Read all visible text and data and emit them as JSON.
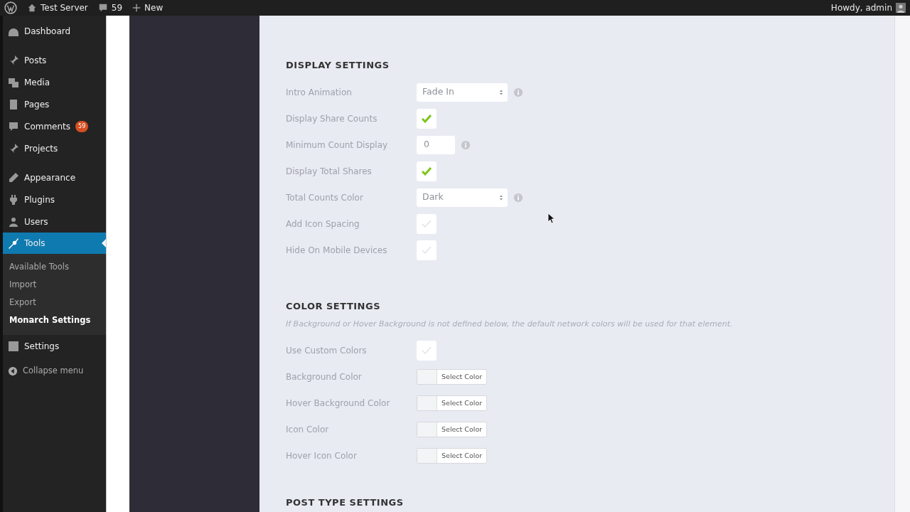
{
  "admin_bar": {
    "site": "Test Server",
    "comments": "59",
    "new": "New",
    "greeting": "Howdy, admin"
  },
  "sidebar": {
    "groups": [
      {
        "items": [
          {
            "label": "Dashboard",
            "selected": false
          }
        ]
      },
      {
        "items": [
          {
            "label": "Posts",
            "selected": false
          },
          {
            "label": "Media",
            "selected": false
          },
          {
            "label": "Pages",
            "selected": false
          },
          {
            "label": "Comments",
            "selected": false,
            "badge": "59"
          },
          {
            "label": "Projects",
            "selected": false
          }
        ]
      },
      {
        "items": [
          {
            "label": "Appearance",
            "selected": false
          },
          {
            "label": "Plugins",
            "selected": false
          },
          {
            "label": "Users",
            "selected": false
          },
          {
            "label": "Tools",
            "selected": true,
            "submenu": [
              {
                "label": "Available Tools",
                "selected": false
              },
              {
                "label": "Import",
                "selected": false
              },
              {
                "label": "Export",
                "selected": false
              },
              {
                "label": "Monarch Settings",
                "selected": true
              }
            ]
          },
          {
            "label": "Settings",
            "selected": false
          }
        ]
      }
    ],
    "collapse": "Collapse menu"
  },
  "sections": [
    {
      "title": "DISPLAY SETTINGS",
      "rows": [
        {
          "kind": "select",
          "label": "Intro Animation",
          "value": "Fade In",
          "info": true
        },
        {
          "kind": "checkbox",
          "label": "Display Share Counts",
          "checked": true
        },
        {
          "kind": "number",
          "label": "Minimum Count Display",
          "value": "0",
          "info": true
        },
        {
          "kind": "checkbox",
          "label": "Display Total Shares",
          "checked": true
        },
        {
          "kind": "select",
          "label": "Total Counts Color",
          "value": "Dark",
          "info": true
        },
        {
          "kind": "checkbox",
          "label": "Add Icon Spacing",
          "checked": false
        },
        {
          "kind": "checkbox",
          "label": "Hide On Mobile Devices",
          "checked": false
        }
      ]
    },
    {
      "title": "COLOR SETTINGS",
      "note": "If Background or Hover Background is not defined below, the default network colors will be used for that element.",
      "rows": [
        {
          "kind": "checkbox",
          "label": "Use Custom Colors",
          "checked": false
        },
        {
          "kind": "color",
          "label": "Background Color",
          "button": "Select Color"
        },
        {
          "kind": "color",
          "label": "Hover Background Color",
          "button": "Select Color"
        },
        {
          "kind": "color",
          "label": "Icon Color",
          "button": "Select Color"
        },
        {
          "kind": "color",
          "label": "Hover Icon Color",
          "button": "Select Color"
        }
      ]
    },
    {
      "title": "POST TYPE SETTINGS"
    }
  ]
}
